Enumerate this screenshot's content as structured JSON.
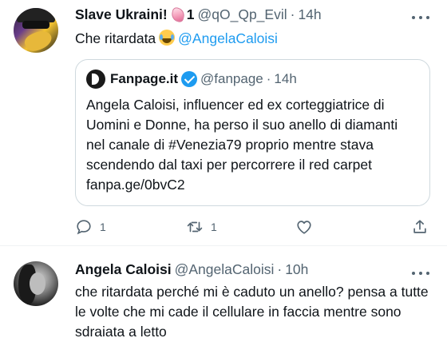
{
  "tweet1": {
    "display_name": "Slave Ukraini!",
    "badge": "1",
    "handle": "@qO_Qp_Evil",
    "separator": "·",
    "time": "14h",
    "text_before": "Che ritardata",
    "mention": "@AngelaCaloisi",
    "emoji": "face-with-tears-of-joy",
    "quote": {
      "name": "Fanpage.it",
      "handle": "@fanpage",
      "separator": "·",
      "time": "14h",
      "text": "Angela Caloisi, influencer ed ex corteggiatrice di\nUomini e Donne, ha perso il suo anello di diamanti\nnel canale di #Venezia79  proprio mentre stava\nscendendo dal taxi per percorrere il red carpet\nfanpa.ge/0bvC2"
    },
    "actions": {
      "reply_count": "1",
      "retweet_count": "1",
      "like_count": "",
      "share_count": ""
    }
  },
  "tweet2": {
    "display_name": "Angela Caloisi",
    "handle": "@AngelaCaloisi",
    "separator": "·",
    "time": "10h",
    "text": "che ritardata perché mi è caduto un anello? pensa a tutte le volte che mi cade il cellulare in faccia mentre sono sdraiata a letto"
  },
  "colors": {
    "accent": "#1d9bf0",
    "text": "#0f1419",
    "secondary": "#536471",
    "border": "#cfd9de"
  },
  "icons": [
    "more-icon",
    "reply-icon",
    "retweet-icon",
    "like-icon",
    "share-icon",
    "verified-icon",
    "fanpage-logo-icon"
  ]
}
